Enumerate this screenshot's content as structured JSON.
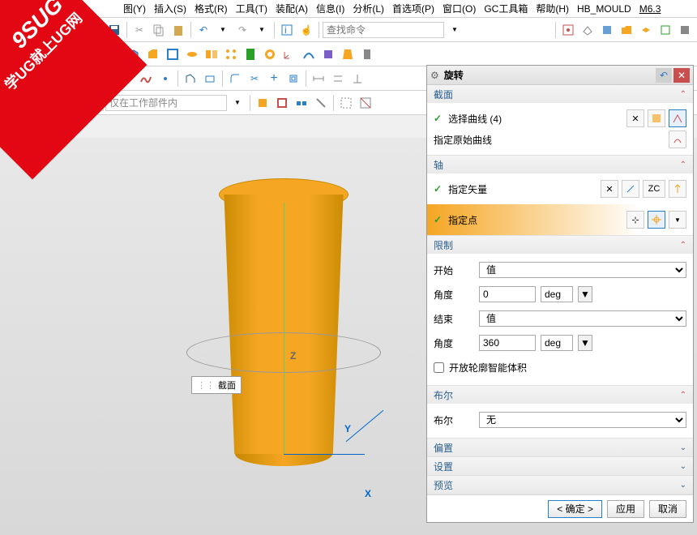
{
  "menu": [
    "图(Y)",
    "插入(S)",
    "格式(R)",
    "工具(T)",
    "装配(A)",
    "信息(I)",
    "分析(L)",
    "首选项(P)",
    "窗口(O)",
    "GC工具箱",
    "帮助(H)",
    "HB_MOULD",
    "M6.3"
  ],
  "toolbar1": {
    "search_placeholder": "查找命令"
  },
  "toolbar4": {
    "filter_placeholder": "仅在工作部件内"
  },
  "watermark": {
    "line1": "9SUG",
    "line2": "学UG就上UG网"
  },
  "viewport": {
    "section_label": "截面",
    "axis": {
      "x": "X",
      "y": "Y",
      "z": "Z"
    }
  },
  "panel": {
    "title": "旋转",
    "sections": {
      "section": {
        "hdr": "截面",
        "select_curve": "选择曲线 (4)",
        "orig_curve": "指定原始曲线"
      },
      "axis": {
        "hdr": "轴",
        "vector": "指定矢量",
        "point": "指定点",
        "zc": "ZC"
      },
      "limits": {
        "hdr": "限制",
        "start_lbl": "开始",
        "start_opt": "值",
        "angle1_lbl": "角度",
        "angle1_val": "0",
        "angle1_unit": "deg",
        "end_lbl": "结束",
        "end_opt": "值",
        "angle2_lbl": "角度",
        "angle2_val": "360",
        "angle2_unit": "deg",
        "open_profile": "开放轮廓智能体积"
      },
      "boolean": {
        "hdr": "布尔",
        "lbl": "布尔",
        "opt": "无"
      },
      "offset": {
        "hdr": "偏置"
      },
      "settings": {
        "hdr": "设置"
      },
      "preview": {
        "hdr": "预览"
      }
    },
    "footer": {
      "ok": "确定",
      "apply": "应用",
      "cancel": "取消"
    }
  }
}
